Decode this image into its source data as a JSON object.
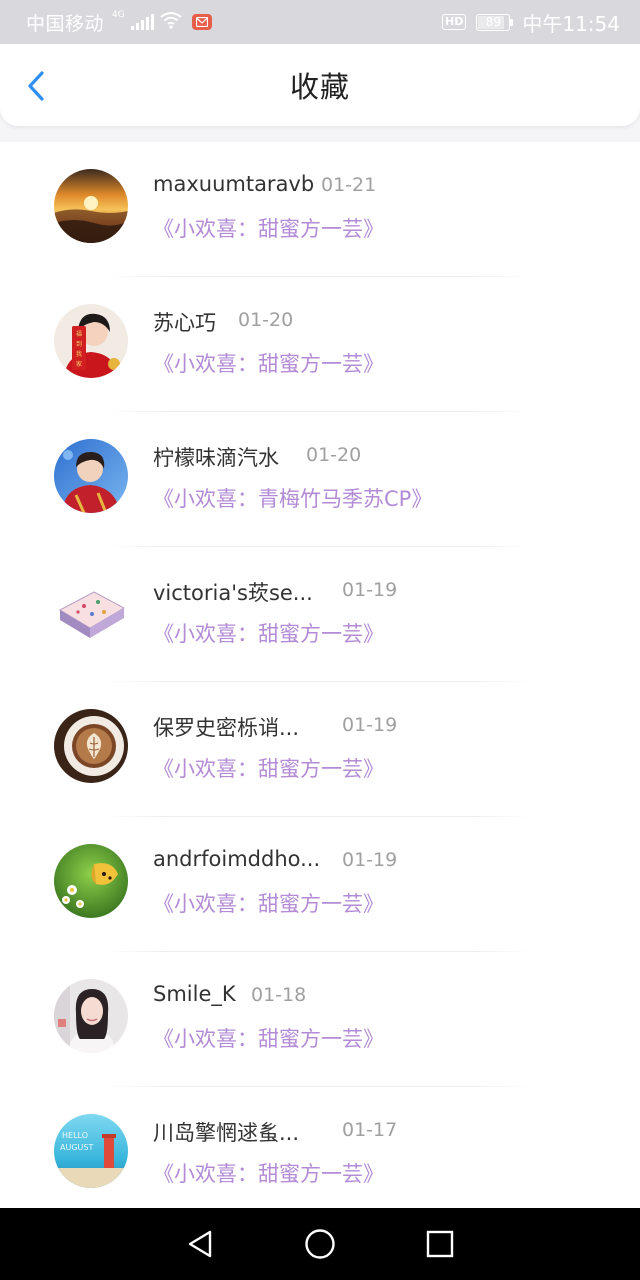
{
  "status_bar": {
    "carrier": "中国移动",
    "network": "4G",
    "hd": "HD",
    "battery": "89",
    "battery_level": 0.89,
    "time": "中午11:54",
    "icons": [
      "signal-icon",
      "wifi-icon",
      "mail-icon",
      "battery-icon"
    ]
  },
  "header": {
    "title": "收藏",
    "back_icon": "chevron-left-icon"
  },
  "favorites": [
    {
      "name": "maxuumtaravb",
      "date": "01-21",
      "work": "《小欢喜：甜蜜方一芸》"
    },
    {
      "name": "苏心巧",
      "date": "01-20",
      "work": "《小欢喜：甜蜜方一芸》"
    },
    {
      "name": "柠檬味滴汽水",
      "date": "01-20",
      "work": "《小欢喜：青梅竹马季苏CP》"
    },
    {
      "name": "victoria's莰se...",
      "date": "01-19",
      "work": "《小欢喜：甜蜜方一芸》"
    },
    {
      "name": "保罗史密栎诮...",
      "date": "01-19",
      "work": "《小欢喜：甜蜜方一芸》"
    },
    {
      "name": "andrfoimddho...",
      "date": "01-19",
      "work": "《小欢喜：甜蜜方一芸》"
    },
    {
      "name": "Smile_K",
      "date": "01-18",
      "work": "《小欢喜：甜蜜方一芸》"
    },
    {
      "name": "川岛擎惘逑蚃...",
      "date": "01-17",
      "work": "《小欢喜：甜蜜方一芸》"
    }
  ],
  "avatar_texts": {
    "red_scroll": "福到我家",
    "beach_sign": "HELLO AUGUST"
  },
  "nav_bar": {
    "icons": [
      "back-triangle-icon",
      "home-circle-icon",
      "recents-square-icon"
    ]
  },
  "colors": {
    "accent": "#2f8ff0",
    "work_title": "#b38bd6",
    "date": "#a0a0a0",
    "status_bar": "#d9d9dd"
  }
}
